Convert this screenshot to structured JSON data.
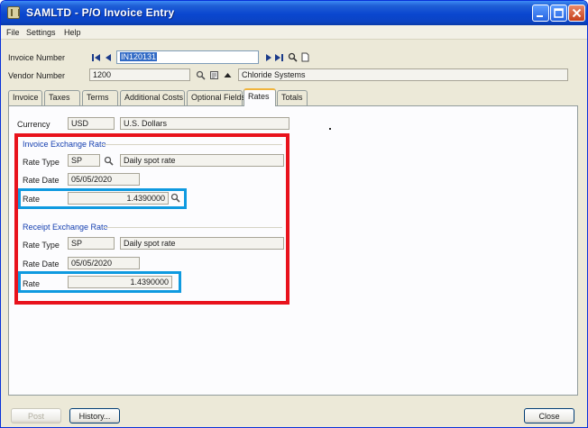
{
  "window": {
    "title": "SAMLTD - P/O Invoice Entry",
    "accent_color": "#0a46cf",
    "controls": [
      "minimize-icon",
      "maximize-icon",
      "close-icon"
    ]
  },
  "menu": [
    "File",
    "Settings",
    "Help"
  ],
  "header": {
    "invoice_number_label": "Invoice Number",
    "invoice_number_value": "IN120131",
    "vendor_number_label": "Vendor Number",
    "vendor_number_value": "1200",
    "vendor_name": "Chloride Systems"
  },
  "tabs": [
    "Invoice",
    "Taxes",
    "Terms",
    "Additional Costs",
    "Optional Fields",
    "Rates",
    "Totals"
  ],
  "active_tab": "Rates",
  "rates": {
    "currency_label": "Currency",
    "currency_code": "USD",
    "currency_name": "U.S. Dollars",
    "invoice_group": {
      "title": "Invoice Exchange Rate",
      "rate_type_label": "Rate Type",
      "rate_type_code": "SP",
      "rate_type_desc": "Daily spot rate",
      "rate_date_label": "Rate Date",
      "rate_date_value": "05/05/2020",
      "rate_label": "Rate",
      "rate_value": "1.4390000"
    },
    "receipt_group": {
      "title": "Receipt Exchange Rate",
      "rate_type_label": "Rate Type",
      "rate_type_code": "SP",
      "rate_type_desc": "Daily spot rate",
      "rate_date_label": "Rate Date",
      "rate_date_value": "05/05/2020",
      "rate_label": "Rate",
      "rate_value": "1.4390000"
    }
  },
  "footer": {
    "post_label": "Post",
    "history_label": "History...",
    "close_label": "Close"
  },
  "highlight_colors": {
    "red": "#e8121c",
    "blue": "#0f9ae0"
  }
}
